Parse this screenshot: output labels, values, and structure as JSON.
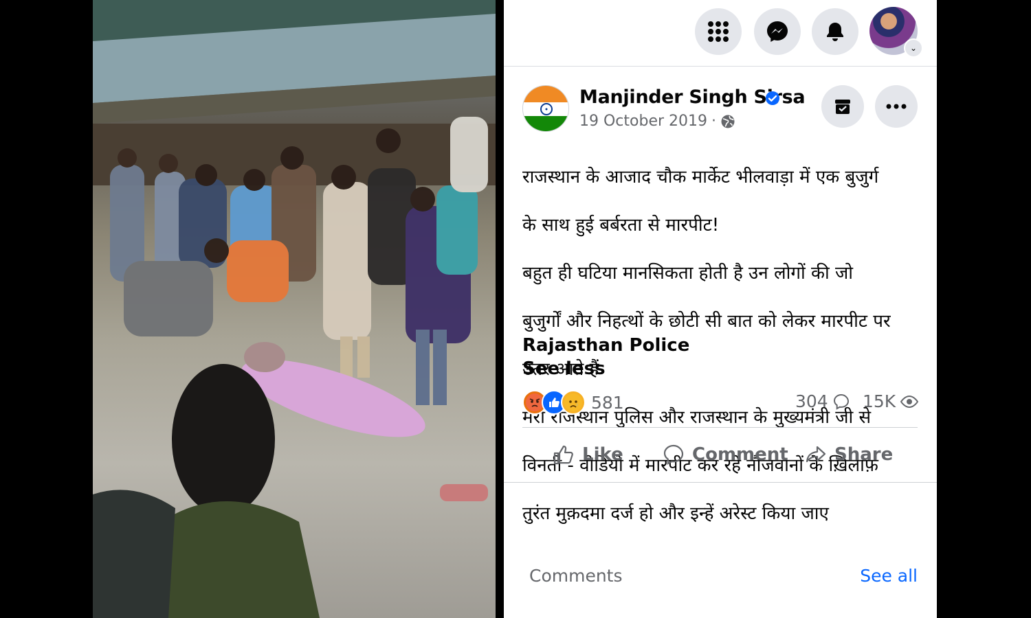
{
  "topbar": {
    "icons": [
      "menu-grid-icon",
      "messenger-icon",
      "notifications-bell-icon",
      "profile-picture",
      "chevron-down-icon"
    ]
  },
  "post": {
    "author": "Manjinder Singh Sirsa",
    "date": "19 October 2019",
    "separator": "·",
    "text_lines": [
      "राजस्थान के आजाद चौक मार्केट भीलवाड़ा में एक बुजुर्ग",
      "के साथ हुई बर्बरता से मारपीट!",
      "बहुत ही घटिया मानसिकता होती है उन लोगों की जो",
      "बुजुर्गों और निहत्थों के छोटी सी बात को लेकर मारपीट पर",
      "उतर आते हैं",
      "मेरी राजस्थान पुलिस और राजस्थान के मुख्यमंत्री जी से",
      "विनती - वीडियो में मारपीट कर रहे नौजवानों के ख़िलाफ़",
      "तुरंत मुक़दमा दर्ज हो और इन्हें अरेस्ट किया जाए"
    ],
    "page_tag": "Rajasthan Police",
    "see_less": "See less"
  },
  "stats": {
    "reactions": "581",
    "reaction_icons": [
      "angry-reaction",
      "like-reaction",
      "sad-reaction"
    ],
    "comments": "304",
    "views": "15K"
  },
  "actions": {
    "like": "Like",
    "comment": "Comment",
    "share": "Share"
  },
  "comments_section": {
    "label": "Comments",
    "see_all": "See all"
  },
  "colors": {
    "link_blue": "#0866ff",
    "secondary_text": "#65676b",
    "button_bg": "#e4e6eb",
    "verified_blue": "#0866ff"
  }
}
